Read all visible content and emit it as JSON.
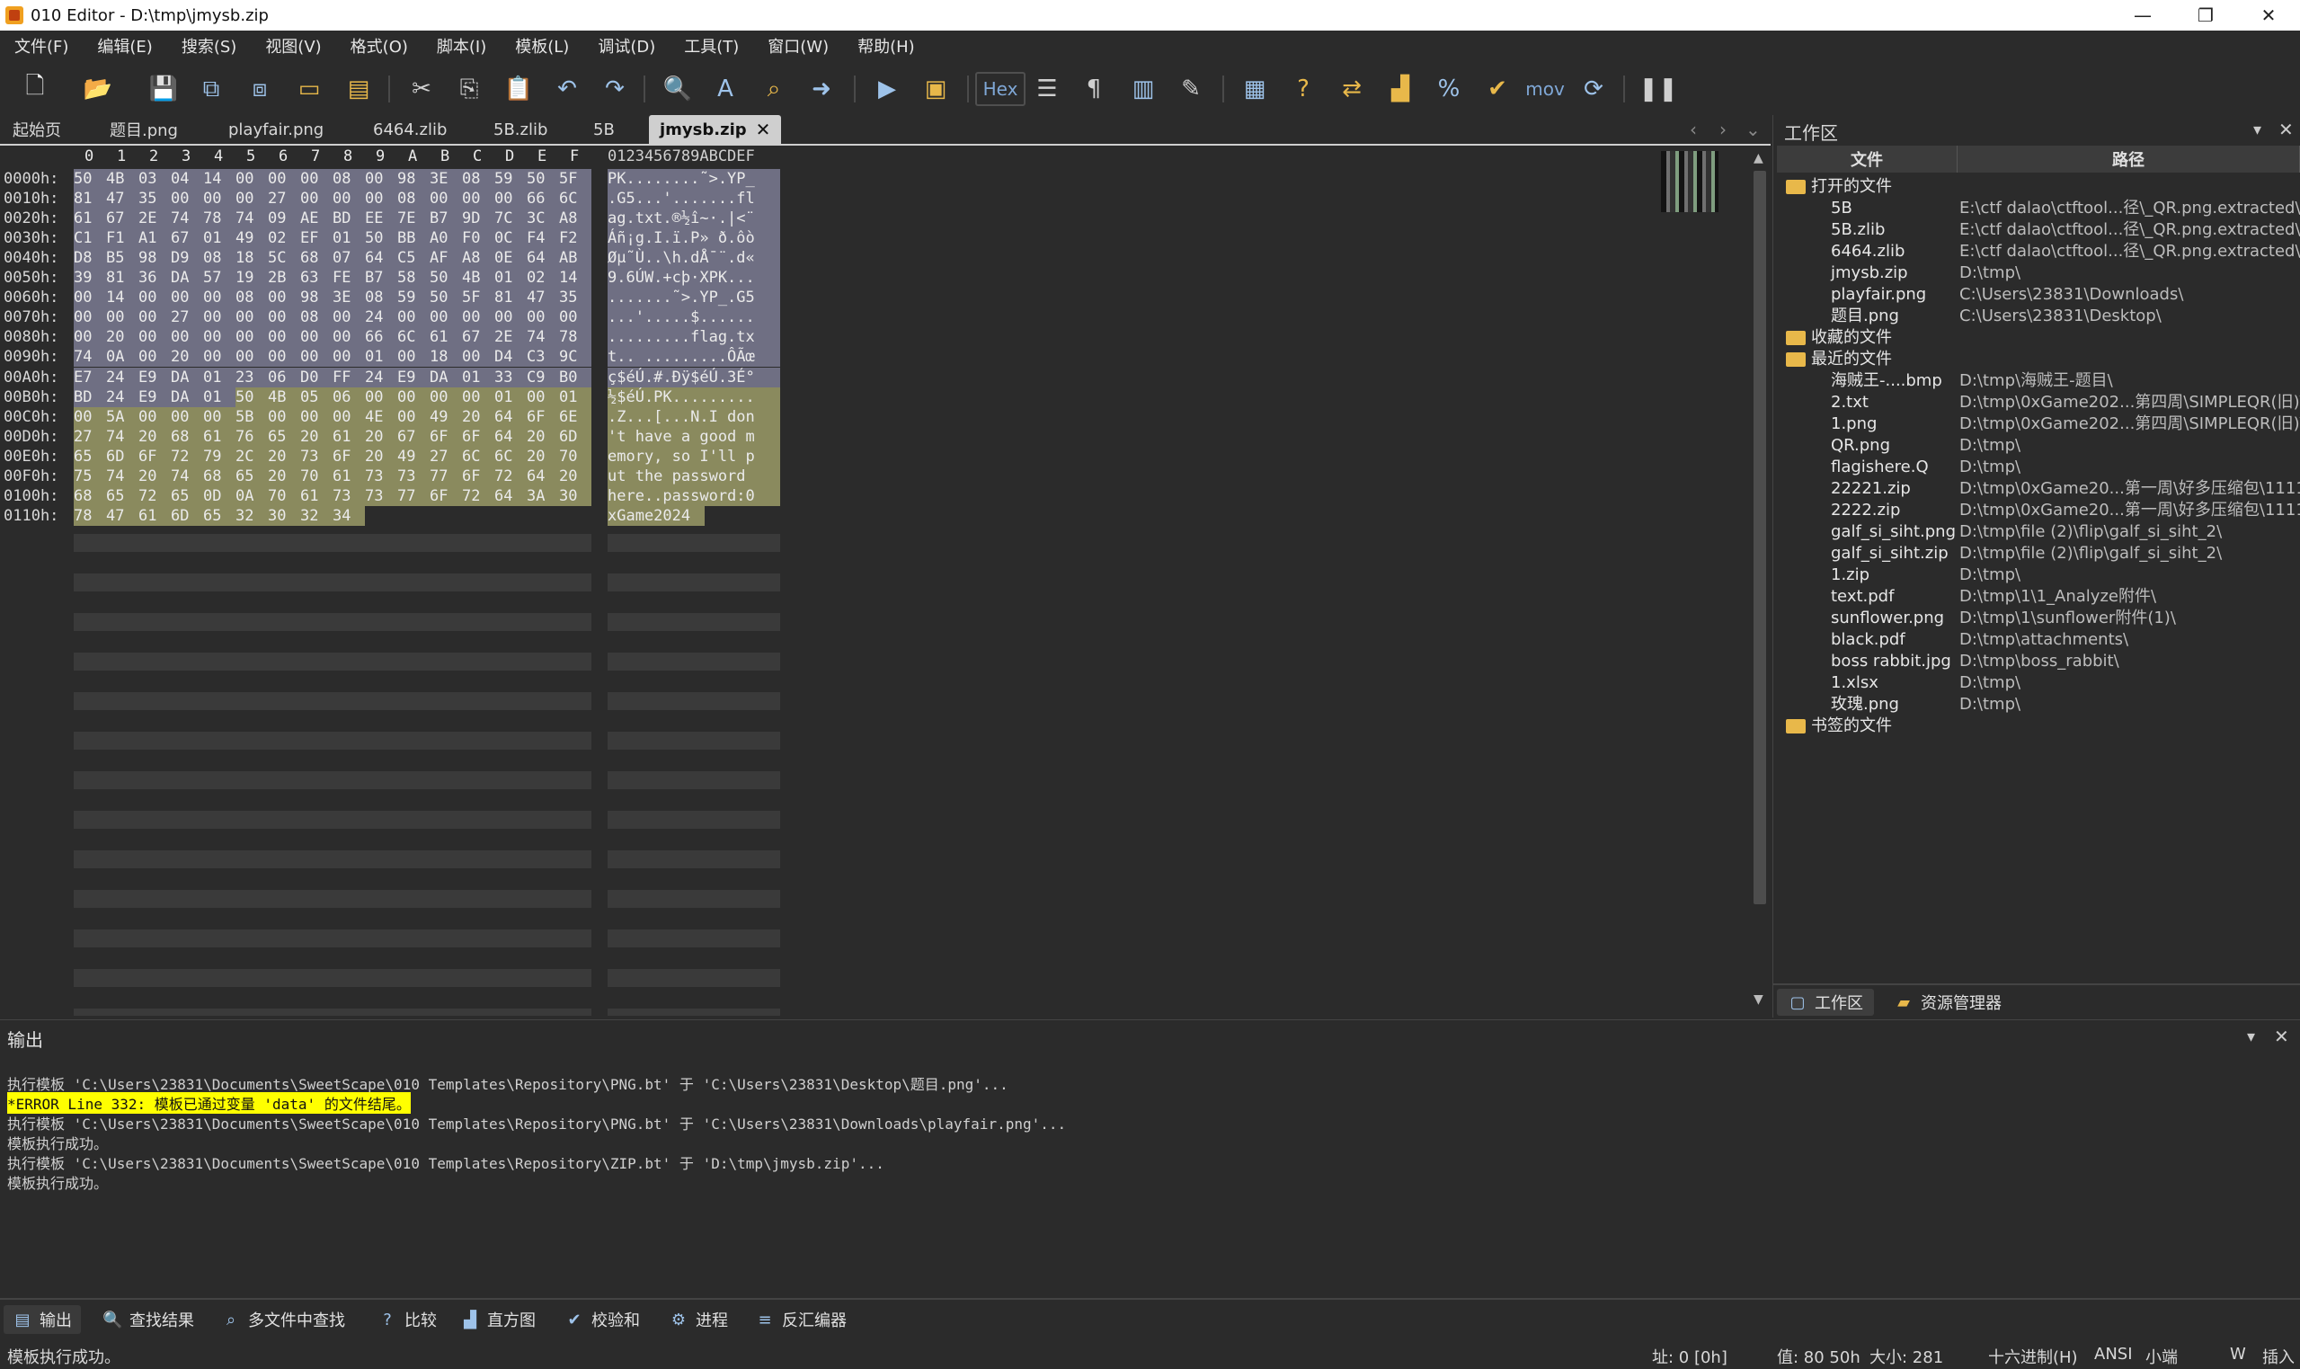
{
  "window": {
    "title": "010 Editor - D:\\tmp\\jmysb.zip",
    "minimize": "—",
    "restore": "❐",
    "close": "✕"
  },
  "menu": [
    "文件(F)",
    "编辑(E)",
    "搜索(S)",
    "视图(V)",
    "格式(O)",
    "脚本(I)",
    "模板(L)",
    "调试(D)",
    "工具(T)",
    "窗口(W)",
    "帮助(H)"
  ],
  "toolbar": {
    "hex_label": "Hex",
    "mov_label": "mov",
    "icons": [
      "new-file-icon",
      "open-file-icon",
      "save-icon",
      "save-as-icon",
      "save-all-icon",
      "open-folder-icon",
      "multi-open-icon",
      "cut-icon",
      "copy-icon",
      "paste-icon",
      "undo-icon",
      "redo-icon",
      "find-icon",
      "replace-icon",
      "find-in-files-icon",
      "goto-icon",
      "run-script-icon",
      "run-template-icon",
      "hex-mode-icon",
      "columns-icon",
      "pilcrow-icon",
      "split-icon",
      "highlight-icon",
      "calculator-icon",
      "help-icon",
      "compare-icon",
      "histogram-icon",
      "percent-icon",
      "checksum-icon",
      "disasm-icon",
      "base-convert-icon",
      "pause-icon"
    ]
  },
  "tabs": [
    {
      "label": "起始页"
    },
    {
      "label": "题目.png"
    },
    {
      "label": "playfair.png"
    },
    {
      "label": "6464.zlib"
    },
    {
      "label": "5B.zlib"
    },
    {
      "label": "5B"
    },
    {
      "label": "jmysb.zip",
      "active": true
    }
  ],
  "hex": {
    "header_cols": [
      "0",
      "1",
      "2",
      "3",
      "4",
      "5",
      "6",
      "7",
      "8",
      "9",
      "A",
      "B",
      "C",
      "D",
      "E",
      "F"
    ],
    "text_header": "0123456789ABCDEF",
    "rows": [
      {
        "addr": "0000h:",
        "bytes": [
          "50",
          "4B",
          "03",
          "04",
          "14",
          "00",
          "00",
          "00",
          "08",
          "00",
          "98",
          "3E",
          "08",
          "59",
          "50",
          "5F"
        ],
        "text": "PK........˜>.YP_"
      },
      {
        "addr": "0010h:",
        "bytes": [
          "81",
          "47",
          "35",
          "00",
          "00",
          "00",
          "27",
          "00",
          "00",
          "00",
          "08",
          "00",
          "00",
          "00",
          "66",
          "6C"
        ],
        "text": ".G5...'.......fl"
      },
      {
        "addr": "0020h:",
        "bytes": [
          "61",
          "67",
          "2E",
          "74",
          "78",
          "74",
          "09",
          "AE",
          "BD",
          "EE",
          "7E",
          "B7",
          "9D",
          "7C",
          "3C",
          "A8"
        ],
        "text": "ag.txt.®½î~·.|<¨"
      },
      {
        "addr": "0030h:",
        "bytes": [
          "C1",
          "F1",
          "A1",
          "67",
          "01",
          "49",
          "02",
          "EF",
          "01",
          "50",
          "BB",
          "A0",
          "F0",
          "0C",
          "F4",
          "F2"
        ],
        "text": "Áñ¡g.I.ï.P» ð.ôò"
      },
      {
        "addr": "0040h:",
        "bytes": [
          "D8",
          "B5",
          "98",
          "D9",
          "08",
          "18",
          "5C",
          "68",
          "07",
          "64",
          "C5",
          "AF",
          "A8",
          "0E",
          "64",
          "AB"
        ],
        "text": "Øµ˜Ù..\\h.dÅ¯¨.d«"
      },
      {
        "addr": "0050h:",
        "bytes": [
          "39",
          "81",
          "36",
          "DA",
          "57",
          "19",
          "2B",
          "63",
          "FE",
          "B7",
          "58",
          "50",
          "4B",
          "01",
          "02",
          "14"
        ],
        "text": "9.6ÚW.+cþ·XPK..."
      },
      {
        "addr": "0060h:",
        "bytes": [
          "00",
          "14",
          "00",
          "00",
          "00",
          "08",
          "00",
          "98",
          "3E",
          "08",
          "59",
          "50",
          "5F",
          "81",
          "47",
          "35"
        ],
        "text": ".......˜>.YP_.G5"
      },
      {
        "addr": "0070h:",
        "bytes": [
          "00",
          "00",
          "00",
          "27",
          "00",
          "00",
          "00",
          "08",
          "00",
          "24",
          "00",
          "00",
          "00",
          "00",
          "00",
          "00"
        ],
        "text": "...'.....$......"
      },
      {
        "addr": "0080h:",
        "bytes": [
          "00",
          "20",
          "00",
          "00",
          "00",
          "00",
          "00",
          "00",
          "00",
          "66",
          "6C",
          "61",
          "67",
          "2E",
          "74",
          "78"
        ],
        "text": ".........flag.tx"
      },
      {
        "addr": "0090h:",
        "bytes": [
          "74",
          "0A",
          "00",
          "20",
          "00",
          "00",
          "00",
          "00",
          "00",
          "01",
          "00",
          "18",
          "00",
          "D4",
          "C3",
          "9C"
        ],
        "text": "t.. .........ÔÃœ"
      },
      {
        "addr": "00A0h:",
        "bytes": [
          "E7",
          "24",
          "E9",
          "DA",
          "01",
          "23",
          "06",
          "D0",
          "FF",
          "24",
          "E9",
          "DA",
          "01",
          "33",
          "C9",
          "B0"
        ],
        "text": "ç$éÚ.#.Ðÿ$éÚ.3É°"
      },
      {
        "addr": "00B0h:",
        "bytes": [
          "BD",
          "24",
          "E9",
          "DA",
          "01",
          "50",
          "4B",
          "05",
          "06",
          "00",
          "00",
          "00",
          "00",
          "01",
          "00",
          "01"
        ],
        "text": "½$éÚ.PK........."
      },
      {
        "addr": "00C0h:",
        "bytes": [
          "00",
          "5A",
          "00",
          "00",
          "00",
          "5B",
          "00",
          "00",
          "00",
          "4E",
          "00",
          "49",
          "20",
          "64",
          "6F",
          "6E"
        ],
        "text": ".Z...[...N.I don"
      },
      {
        "addr": "00D0h:",
        "bytes": [
          "27",
          "74",
          "20",
          "68",
          "61",
          "76",
          "65",
          "20",
          "61",
          "20",
          "67",
          "6F",
          "6F",
          "64",
          "20",
          "6D"
        ],
        "text": "'t have a good m"
      },
      {
        "addr": "00E0h:",
        "bytes": [
          "65",
          "6D",
          "6F",
          "72",
          "79",
          "2C",
          "20",
          "73",
          "6F",
          "20",
          "49",
          "27",
          "6C",
          "6C",
          "20",
          "70"
        ],
        "text": "emory, so I'll p"
      },
      {
        "addr": "00F0h:",
        "bytes": [
          "75",
          "74",
          "20",
          "74",
          "68",
          "65",
          "20",
          "70",
          "61",
          "73",
          "73",
          "77",
          "6F",
          "72",
          "64",
          "20"
        ],
        "text": "ut the password "
      },
      {
        "addr": "0100h:",
        "bytes": [
          "68",
          "65",
          "72",
          "65",
          "0D",
          "0A",
          "70",
          "61",
          "73",
          "73",
          "77",
          "6F",
          "72",
          "64",
          "3A",
          "30"
        ],
        "text": "here..password:0"
      },
      {
        "addr": "0110h:",
        "bytes": [
          "78",
          "47",
          "61",
          "6D",
          "65",
          "32",
          "30",
          "32",
          "34"
        ],
        "text": "xGame2024"
      }
    ]
  },
  "workspace": {
    "title": "工作区",
    "col_file": "文件",
    "col_path": "路径",
    "groups": [
      {
        "label": "打开的文件",
        "items": [
          {
            "name": "5B",
            "path": "E:\\ctf dalao\\ctftool...径\\_QR.png.extracted\\"
          },
          {
            "name": "5B.zlib",
            "path": "E:\\ctf dalao\\ctftool...径\\_QR.png.extracted\\"
          },
          {
            "name": "6464.zlib",
            "path": "E:\\ctf dalao\\ctftool...径\\_QR.png.extracted\\"
          },
          {
            "name": "jmysb.zip",
            "path": "D:\\tmp\\"
          },
          {
            "name": "playfair.png",
            "path": "C:\\Users\\23831\\Downloads\\"
          },
          {
            "name": "题目.png",
            "path": "C:\\Users\\23831\\Desktop\\"
          }
        ]
      },
      {
        "label": "收藏的文件",
        "items": []
      },
      {
        "label": "最近的文件",
        "items": [
          {
            "name": "海贼王-....bmp",
            "path": "D:\\tmp\\海贼王-题目\\"
          },
          {
            "name": "2.txt",
            "path": "D:\\tmp\\0xGame202...第四周\\SIMPLEQR(旧)\\"
          },
          {
            "name": "1.png",
            "path": "D:\\tmp\\0xGame202...第四周\\SIMPLEQR(旧)\\"
          },
          {
            "name": "QR.png",
            "path": "D:\\tmp\\"
          },
          {
            "name": "flagishere.Q",
            "path": "D:\\tmp\\"
          },
          {
            "name": "22221.zip",
            "path": "D:\\tmp\\0xGame20...第一周\\好多压缩包\\1111\\"
          },
          {
            "name": "2222.zip",
            "path": "D:\\tmp\\0xGame20...第一周\\好多压缩包\\1111\\"
          },
          {
            "name": "galf_si_siht.png",
            "path": "D:\\tmp\\file (2)\\flip\\galf_si_siht_2\\"
          },
          {
            "name": "galf_si_siht.zip",
            "path": "D:\\tmp\\file (2)\\flip\\galf_si_siht_2\\"
          },
          {
            "name": "1.zip",
            "path": "D:\\tmp\\"
          },
          {
            "name": "text.pdf",
            "path": "D:\\tmp\\1\\1_Analyze附件\\"
          },
          {
            "name": "sunflower.png",
            "path": "D:\\tmp\\1\\sunflower附件(1)\\"
          },
          {
            "name": "black.pdf",
            "path": "D:\\tmp\\attachments\\"
          },
          {
            "name": "boss rabbit.jpg",
            "path": "D:\\tmp\\boss_rabbit\\"
          },
          {
            "name": "1.xlsx",
            "path": "D:\\tmp\\"
          },
          {
            "name": "玫瑰.png",
            "path": "D:\\tmp\\"
          }
        ]
      },
      {
        "label": "书签的文件",
        "items": []
      }
    ],
    "tab_workspace": "工作区",
    "tab_explorer": "资源管理器"
  },
  "output": {
    "title": "输出",
    "lines": [
      {
        "text": "执行模板 'C:\\Users\\23831\\Documents\\SweetScape\\010 Templates\\Repository\\PNG.bt' 于 'C:\\Users\\23831\\Desktop\\题目.png'...",
        "error": false
      },
      {
        "text": "*ERROR Line 332: 模板已通过变量 'data' 的文件结尾。",
        "error": true
      },
      {
        "text": "执行模板 'C:\\Users\\23831\\Documents\\SweetScape\\010 Templates\\Repository\\PNG.bt' 于 'C:\\Users\\23831\\Downloads\\playfair.png'...",
        "error": false
      },
      {
        "text": "模板执行成功。",
        "error": false
      },
      {
        "text": "执行模板 'C:\\Users\\23831\\Documents\\SweetScape\\010 Templates\\Repository\\ZIP.bt' 于 'D:\\tmp\\jmysb.zip'...",
        "error": false
      },
      {
        "text": "模板执行成功。",
        "error": false
      }
    ]
  },
  "bottom_tabs": [
    {
      "label": "输出",
      "icon": "output-icon",
      "active": true
    },
    {
      "label": "查找结果",
      "icon": "search-results-icon"
    },
    {
      "label": "多文件中查找",
      "icon": "find-in-files-icon"
    },
    {
      "label": "比较",
      "icon": "compare-icon"
    },
    {
      "label": "直方图",
      "icon": "histogram-icon"
    },
    {
      "label": "校验和",
      "icon": "checksum-icon"
    },
    {
      "label": "进程",
      "icon": "process-icon"
    },
    {
      "label": "反汇编器",
      "icon": "disassembler-icon"
    }
  ],
  "status": {
    "message": "模板执行成功。",
    "address": "址: 0 [0h]",
    "value": "值: 80 50h",
    "size": "大小: 281",
    "mode": "十六进制(H)",
    "encoding": "ANSI",
    "endian": "小端",
    "w": "W",
    "insert": "插入"
  }
}
